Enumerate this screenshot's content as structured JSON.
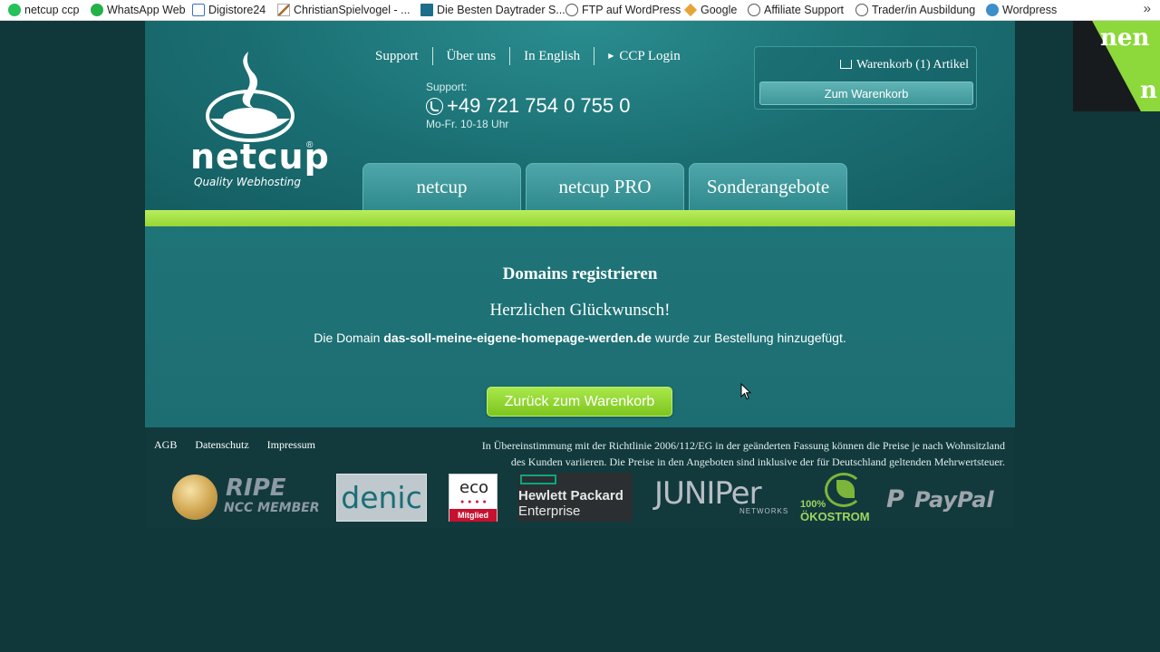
{
  "bookmarks": [
    {
      "label": "netcup ccp",
      "icon": "netcup-icon"
    },
    {
      "label": "WhatsApp Web",
      "icon": "whatsapp-icon"
    },
    {
      "label": "Digistore24",
      "icon": "mail-icon"
    },
    {
      "label": "ChristianSpielvogel - ...",
      "icon": "pen-icon"
    },
    {
      "label": "Die Besten Daytrader S...",
      "icon": "book-icon"
    },
    {
      "label": "FTP auf WordPress",
      "icon": "globe-icon"
    },
    {
      "label": "Google",
      "icon": "google-icon"
    },
    {
      "label": "Affiliate Support",
      "icon": "globe-icon"
    },
    {
      "label": "Trader/in Ausbildung",
      "icon": "globe-icon"
    },
    {
      "label": "Wordpress",
      "icon": "wordpress-icon"
    }
  ],
  "bookmarks_more": "»",
  "logo": {
    "name": "netcup",
    "registered": "®",
    "tagline": "Quality Webhosting"
  },
  "topnav": {
    "support": "Support",
    "about": "Über uns",
    "english": "In English",
    "ccp_arrow": "▶",
    "ccp": "CCP Login"
  },
  "support": {
    "label": "Support:",
    "phone": "+49 721 754 0 755 0",
    "hours": "Mo-Fr. 10-18 Uhr"
  },
  "cart": {
    "summary": "Warenkorb (1) Artikel",
    "button": "Zum Warenkorb"
  },
  "tabs": [
    "netcup",
    "netcup PRO",
    "Sonderangebote"
  ],
  "content": {
    "title": "Domains registrieren",
    "subtitle": "Herzlichen Glückwunsch!",
    "msg_prefix": "Die Domain",
    "domain": "das-soll-meine-eigene-homepage-werden.de",
    "msg_suffix": "wurde zur Bestellung hinzugefügt.",
    "button": "Zurück zum Warenkorb"
  },
  "footer": {
    "links": [
      "AGB",
      "Datenschutz",
      "Impressum"
    ],
    "legal_line1": "In Übereinstimmung mit der Richtlinie 2006/112/EG in der geänderten Fassung können die Preise je nach Wohnsitzland",
    "legal_line2": "des Kunden variieren. Die Preise in den Angeboten sind inklusive der für Deutschland geltenden Mehrwertsteuer."
  },
  "partners": {
    "ripe_1": "RIPE",
    "ripe_2": "NCC MEMBER",
    "denic": "denic",
    "eco": "eco",
    "eco_member": "Mitglied",
    "hpe_1": "Hewlett Packard",
    "hpe_2": "Enterprise",
    "juniper": "JUNIPer",
    "juniper_sub": "NETWORKS",
    "oeko_1": "100%",
    "oeko_2": "ÖKOSTROM",
    "paypal_p": "P",
    "paypal": "PayPal"
  },
  "corner": {
    "line1": "nen",
    "line2": "n"
  },
  "colors": {
    "header": "#1a6e72",
    "accent_green": "#9ad93a",
    "background": "#10373a"
  }
}
